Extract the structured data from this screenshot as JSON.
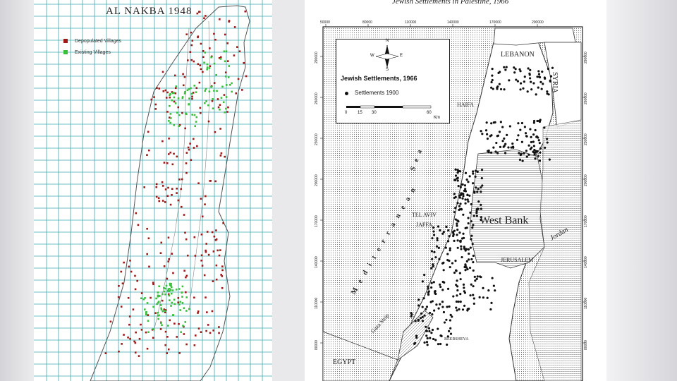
{
  "left_map": {
    "title": "AL NAKBA 1948",
    "legend": [
      {
        "label": "Depopulated Villages",
        "color": "#a01818"
      },
      {
        "label": "Existing Villages",
        "color": "#39c03a"
      }
    ],
    "grid_color": "#3fa9ae"
  },
  "right_map": {
    "title": "Jewish Settlements in Palestine, 1966",
    "legend": {
      "title": "Jewish Settlements, 1966",
      "item": "Settlements 1900",
      "scale_labels": [
        "0",
        "15",
        "30",
        "60"
      ],
      "scale_unit": "Km",
      "compass": [
        "N",
        "E",
        "S",
        "W"
      ]
    },
    "places": {
      "lebanon": "LEBANON",
      "syria": "SYRIA",
      "haifa": "HAIFA",
      "tel_aviv": "TEL AVIV",
      "jaffa": "JAFFA",
      "west_bank": "West Bank",
      "jordan": "Jordan",
      "jerusalem": "JERUSALEM",
      "gaza_strip": "Gaza Strip",
      "beersheva": "BEERSHEVA",
      "egypt": "EGYPT",
      "sea_word1": "Mediterranean",
      "sea_word2": "Sea"
    },
    "x_ticks": [
      "50000",
      "80000",
      "110000",
      "140000",
      "170000",
      "200000"
    ],
    "y_ticks": [
      "290000",
      "260000",
      "230000",
      "200000",
      "170000",
      "140000",
      "110000",
      "80000"
    ]
  }
}
